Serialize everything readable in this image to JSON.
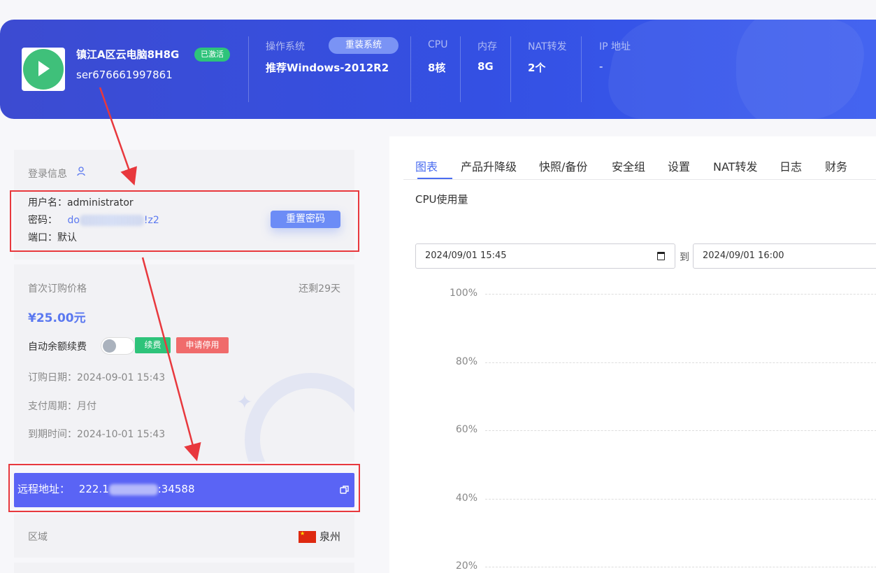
{
  "header": {
    "hostname": "镇江A区云电脑8H8G",
    "status_badge": "已激活",
    "serial": "ser676661997861",
    "os_label": "操作系统",
    "reinstall_button": "重装系统",
    "os_value": "推荐Windows-2012R2",
    "cpu_label": "CPU",
    "cpu_value": "8核",
    "memory_label": "内存",
    "memory_value": "8G",
    "nat_label": "NAT转发",
    "nat_value": "2个",
    "ip_label": "IP 地址",
    "ip_value": "-"
  },
  "login": {
    "title": "登录信息",
    "username_label": "用户名：",
    "username_value": "administrator",
    "password_label": "密码：",
    "password_prefix": "do",
    "password_suffix": "!z2",
    "port_label": "端口：",
    "port_value": "默认",
    "reset_button": "重置密码"
  },
  "billing": {
    "first_price_label": "首次订购价格",
    "remaining": "还剩29天",
    "price": "¥25.00元",
    "auto_renew_label": "自动余额续费",
    "auto_renew_on": false,
    "renew_button": "续费",
    "stop_button": "申请停用",
    "order_date_label": "订购日期：",
    "order_date_value": "2024-09-01 15:43",
    "pay_cycle_label": "支付周期：",
    "pay_cycle_value": "月付",
    "expire_label": "到期时间：",
    "expire_value": "2024-10-01 15:43"
  },
  "remote": {
    "label": "远程地址：",
    "prefix": "222.1",
    "suffix": ":34588"
  },
  "region": {
    "label": "区域",
    "value": "泉州"
  },
  "tabs": [
    "图表",
    "产品升降级",
    "快照/备份",
    "安全组",
    "设置",
    "NAT转发",
    "日志",
    "财务"
  ],
  "chart_section": {
    "title": "CPU使用量",
    "start": "2024/09/01  15:45",
    "to_label": "到",
    "end": "2024/09/01  16:00"
  },
  "chart_data": {
    "type": "line",
    "title": "CPU使用量",
    "y_ticks": [
      "100%",
      "80%",
      "60%",
      "40%",
      "20%"
    ],
    "series": []
  },
  "colors": {
    "accent": "#4a6cf0",
    "banner": "#3450e3",
    "active_green": "#2ec37a",
    "danger": "#f06b6b",
    "annotation_red": "#e8383d"
  }
}
